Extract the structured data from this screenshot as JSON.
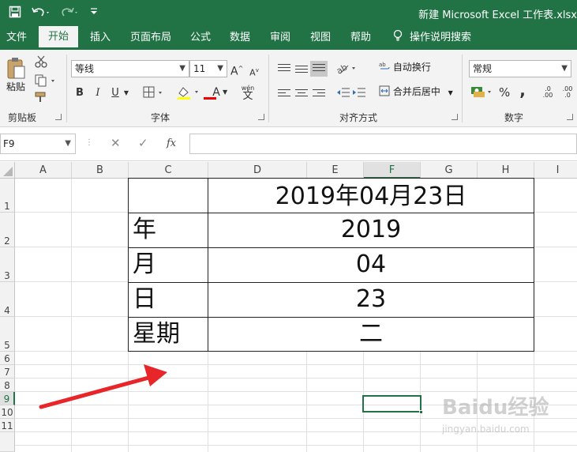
{
  "window": {
    "title": "新建 Microsoft Excel 工作表.xlsx"
  },
  "quick_access": {
    "save_icon": "save-icon",
    "undo_icon": "undo-icon",
    "redo_icon": "redo-icon",
    "customize_icon": "customize-icon"
  },
  "tabs": [
    {
      "label": "文件",
      "active": false
    },
    {
      "label": "开始",
      "active": true
    },
    {
      "label": "插入",
      "active": false
    },
    {
      "label": "页面布局",
      "active": false
    },
    {
      "label": "公式",
      "active": false
    },
    {
      "label": "数据",
      "active": false
    },
    {
      "label": "审阅",
      "active": false
    },
    {
      "label": "视图",
      "active": false
    },
    {
      "label": "帮助",
      "active": false
    }
  ],
  "tell_me": "操作说明搜索",
  "ribbon": {
    "clipboard": {
      "paste_label": "粘贴",
      "group_label": "剪贴板"
    },
    "font": {
      "font_name": "等线",
      "font_size": "11",
      "group_label": "字体",
      "bold": "B",
      "italic": "I",
      "underline": "U",
      "grow": "A",
      "shrink": "A",
      "font_color": "A",
      "phonetic": "wén"
    },
    "alignment": {
      "wrap_text": "自动换行",
      "merge_center": "合并后居中",
      "group_label": "对齐方式"
    },
    "number": {
      "format": "常规",
      "percent": "%",
      "comma": ",",
      "group_label": "数字",
      "inc_decimal": ".00",
      "dec_decimal": ".0"
    }
  },
  "formula_bar": {
    "name_box": "F9",
    "cancel": "✕",
    "enter": "✓",
    "fx": "fx",
    "formula": ""
  },
  "columns": [
    "A",
    "B",
    "C",
    "D",
    "E",
    "F",
    "G",
    "H",
    "I"
  ],
  "selected_column": "F",
  "rows": [
    "1",
    "2",
    "3",
    "4",
    "5",
    "6",
    "7",
    "8",
    "9",
    "10",
    "11"
  ],
  "selected_row": "9",
  "table": {
    "date_title": "2019年04月23日",
    "rows": [
      {
        "label": "年",
        "value": "2019"
      },
      {
        "label": "月",
        "value": "04"
      },
      {
        "label": "日",
        "value": "23"
      },
      {
        "label": "星期",
        "value": "二"
      }
    ]
  },
  "annotation": {
    "arrow_color": "#e8262a"
  },
  "watermark": {
    "line1": "Baidu经验",
    "line2": "jingyan.baidu.com"
  }
}
